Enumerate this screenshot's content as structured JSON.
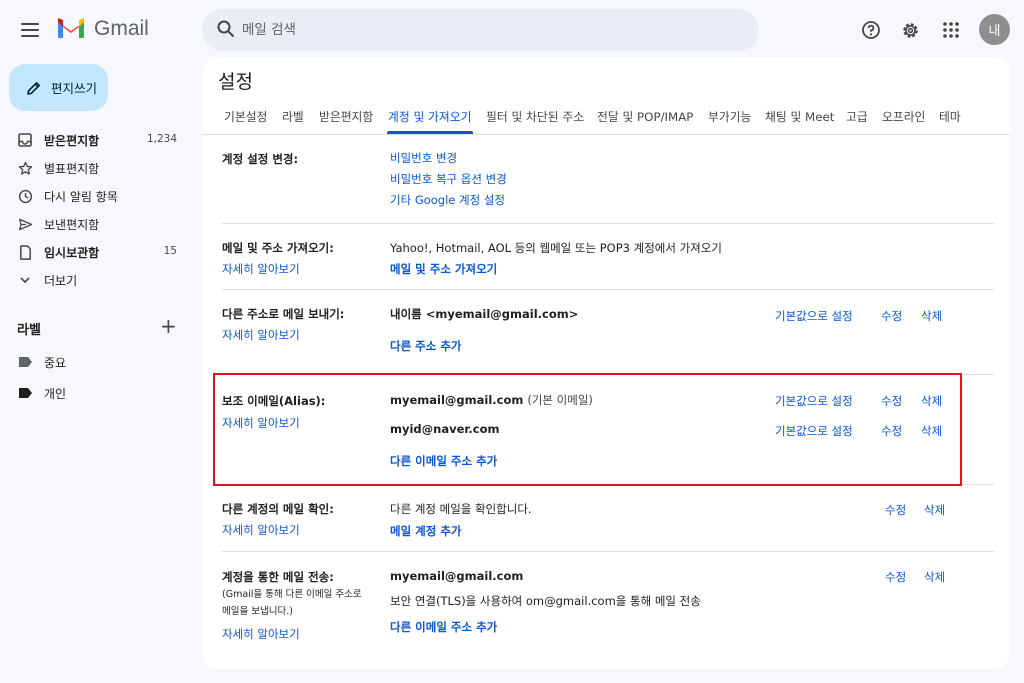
{
  "app": {
    "name": "Gmail",
    "avatar_initial": "내"
  },
  "search": {
    "placeholder": "메일 검색"
  },
  "sidebar": {
    "compose_label": "편지쓰기",
    "items": [
      {
        "label": "받은편지함",
        "count": "1,234"
      },
      {
        "label": "별표편지함"
      },
      {
        "label": "다시 알림 항목"
      },
      {
        "label": "보낸편지함"
      },
      {
        "label": "임시보관함",
        "count": "15"
      },
      {
        "label": "더보기"
      }
    ],
    "labels_title": "라벨",
    "labels": [
      {
        "label": "중요"
      },
      {
        "label": "개인"
      }
    ]
  },
  "settings": {
    "title": "설정",
    "tabs": [
      "기본설정",
      "라벨",
      "받은편지함",
      "계정 및 가져오기",
      "필터 및 차단된 주소",
      "전달 및 POP/IMAP",
      "부가기능",
      "채팅 및 Meet",
      "고급",
      "오프라인",
      "테마"
    ],
    "active_tab": "계정 및 가져오기",
    "sections": {
      "change_account": {
        "label": "계정 설정 변경:",
        "links": [
          "비밀번호 변경",
          "비밀번호 복구 옵션 변경",
          "기타 Google 계정 설정"
        ]
      },
      "import": {
        "label": "메일 및 주소 가져오기:",
        "learn_more": "자세히 알아보기",
        "description": "Yahoo!, Hotmail, AOL 등의 웹메일 또는 POP3 계정에서 가져오기",
        "action": "메일 및 주소 가져오기"
      },
      "send_as": {
        "label": "다른 주소로 메일 보내기:",
        "learn_more": "자세히 알아보기",
        "entry": "내이름 <myemail@gmail.com>",
        "set_default": "기본값으로 설정",
        "edit": "수정",
        "delete": "삭제",
        "add": "다른 주소 추가"
      },
      "alias": {
        "label": "보조 이메일(Alias):",
        "learn_more": "자세히 알아보기",
        "rows": [
          {
            "email": "myemail@gmail.com",
            "note": "(기본 이메일)",
            "set_default": "기본값으로 설정",
            "edit": "수정",
            "delete": "삭제"
          },
          {
            "email": "myid@naver.com",
            "note": "",
            "set_default": "기본값으로 설정",
            "edit": "수정",
            "delete": "삭제"
          }
        ],
        "add": "다른 이메일 주소 추가"
      },
      "check_mail": {
        "label": "다른 계정의 메일 확인:",
        "learn_more": "자세히 알아보기",
        "description": "다른 계정 메일을 확인합니다.",
        "edit": "수정",
        "delete": "삭제",
        "add": "메일 계정 추가"
      },
      "send_through": {
        "label": "계정을 통한 메일 전송:",
        "note_line1": "(Gmail을 통해 다른 이메일 주소로",
        "note_line2": "메일을 보냅니다.)",
        "learn_more": "자세히 알아보기",
        "email": "myemail@gmail.com",
        "description": "보안 연결(TLS)을 사용하여 om@gmail.com을 통해 메일 전송",
        "edit": "수정",
        "delete": "삭제",
        "add": "다른 이메일 주소 추가"
      }
    }
  },
  "colors": {
    "accent": "#0b57d0",
    "highlight_border": "#e8141c",
    "compose_bg": "#c2e7ff"
  }
}
